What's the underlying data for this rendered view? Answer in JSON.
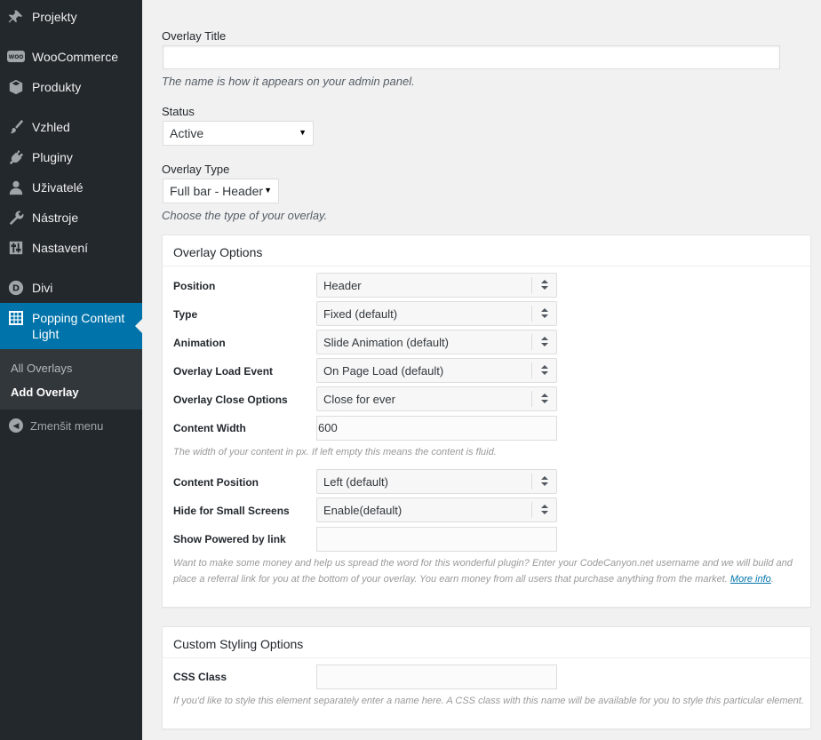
{
  "sidebar": {
    "items": [
      {
        "label": "Projekty",
        "icon": "pushpin-icon"
      },
      {
        "label": "WooCommerce",
        "icon": "woocommerce-icon"
      },
      {
        "label": "Produkty",
        "icon": "box-icon"
      },
      {
        "label": "Vzhled",
        "icon": "paintbrush-icon"
      },
      {
        "label": "Pluginy",
        "icon": "plug-icon"
      },
      {
        "label": "Uživatelé",
        "icon": "user-icon"
      },
      {
        "label": "Nástroje",
        "icon": "wrench-icon"
      },
      {
        "label": "Nastavení",
        "icon": "settings-sliders-icon"
      },
      {
        "label": "Divi",
        "icon": "divi-icon"
      },
      {
        "label": "Popping Content Light",
        "icon": "grid-icon",
        "active": true
      }
    ],
    "submenu": [
      {
        "label": "All Overlays"
      },
      {
        "label": "Add Overlay",
        "current": true
      }
    ],
    "collapse_label": "Zmenšit menu"
  },
  "form": {
    "overlay_title": {
      "label": "Overlay Title",
      "value": "",
      "description": "The name is how it appears on your admin panel."
    },
    "status": {
      "label": "Status",
      "value": "Active"
    },
    "overlay_type": {
      "label": "Overlay Type",
      "value": "Full bar - Header",
      "description": "Choose the type of your overlay."
    }
  },
  "overlay_options": {
    "title": "Overlay Options",
    "position": {
      "label": "Position",
      "value": "Header"
    },
    "type": {
      "label": "Type",
      "value": "Fixed (default)"
    },
    "animation": {
      "label": "Animation",
      "value": "Slide Animation (default)"
    },
    "load_event": {
      "label": "Overlay Load Event",
      "value": "On Page Load (default)"
    },
    "close_options": {
      "label": "Overlay Close Options",
      "value": "Close for ever"
    },
    "content_width": {
      "label": "Content Width",
      "value": "600",
      "description": "The width of your content in px. If left empty this means the content is fluid."
    },
    "content_position": {
      "label": "Content Position",
      "value": "Left (default)"
    },
    "hide_small": {
      "label": "Hide for Small Screens",
      "value": "Enable(default)"
    },
    "powered_by": {
      "label": "Show Powered by link",
      "value": "",
      "description": "Want to make some money and help us spread the word for this wonderful plugin? Enter your CodeCanyon.net username and we will build and place a referral link for you at the bottom of your overlay. You earn money from all users that purchase anything from the market.",
      "link_label": "More info",
      "after_link": "."
    }
  },
  "custom_styling": {
    "title": "Custom Styling Options",
    "css_class": {
      "label": "CSS Class",
      "value": "",
      "description": "If you'd like to style this element separately enter a name here. A CSS class with this name will be available for you to style this particular element."
    }
  },
  "colors": {
    "sidebar_bg": "#23282d",
    "active_bg": "#0073aa",
    "submenu_bg": "#32373c",
    "page_bg": "#f1f1f1"
  }
}
